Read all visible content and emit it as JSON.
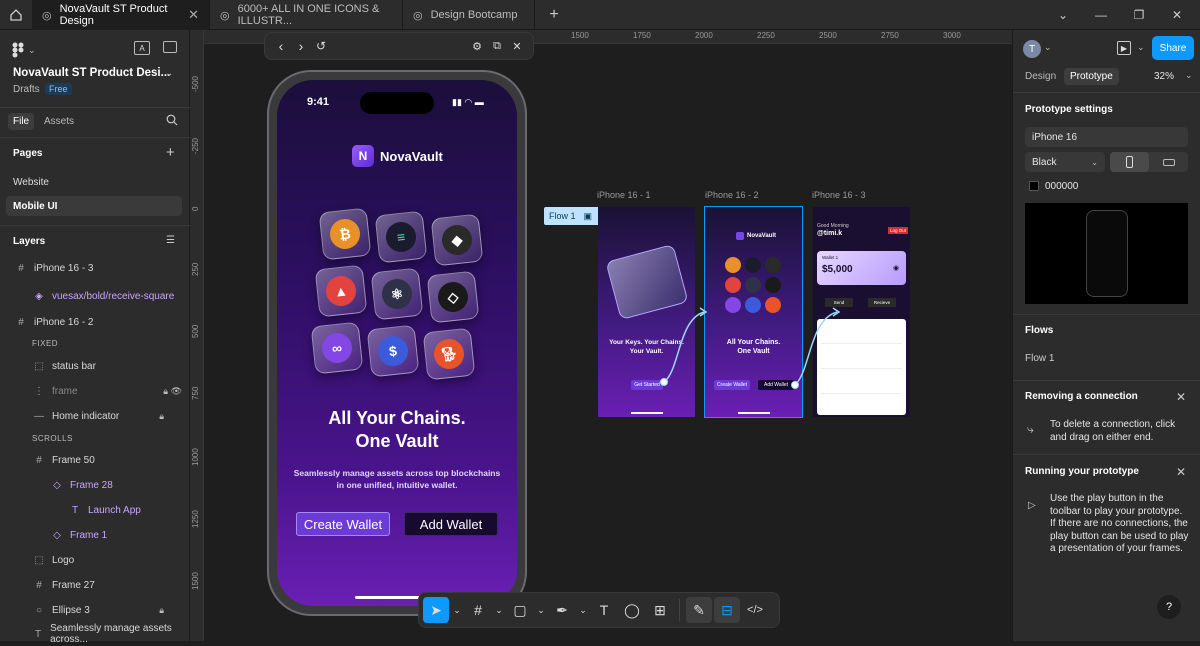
{
  "tabs": [
    {
      "label": "NovaVault ST Product Design",
      "active": true
    },
    {
      "label": "6000+ ALL IN ONE ICONS & ILLUSTR...",
      "active": false
    },
    {
      "label": "Design Bootcamp",
      "active": false
    }
  ],
  "left": {
    "file_title": "NovaVault ST Product Desi...",
    "drafts": "Drafts",
    "plan": "Free",
    "tab_file": "File",
    "tab_assets": "Assets",
    "pages_title": "Pages",
    "pages": [
      "Website",
      "Mobile UI"
    ],
    "layers_title": "Layers",
    "layers": [
      {
        "label": "iPhone 16 - 3",
        "icon": "#"
      },
      {
        "label": "vuesax/bold/receive-square",
        "icon": "◈"
      },
      {
        "label": "iPhone 16 - 2",
        "icon": "#"
      },
      {
        "label": "FIXED",
        "icon": ""
      },
      {
        "label": "status bar",
        "icon": "⬚"
      },
      {
        "label": "frame",
        "icon": "⋮"
      },
      {
        "label": "Home indicator",
        "icon": "—"
      },
      {
        "label": "SCROLLS",
        "icon": ""
      },
      {
        "label": "Frame 50",
        "icon": "#"
      },
      {
        "label": "Frame 28",
        "icon": "◇"
      },
      {
        "label": "Launch App",
        "icon": "T"
      },
      {
        "label": "Frame 1",
        "icon": "◇"
      },
      {
        "label": "Logo",
        "icon": "⬚"
      },
      {
        "label": "Frame 27",
        "icon": "#"
      },
      {
        "label": "Ellipse 3",
        "icon": "○"
      },
      {
        "label": "Seamlessly manage assets across...",
        "icon": "T"
      }
    ]
  },
  "ruler_top": [
    "1500",
    "1750",
    "2000",
    "2250",
    "2500",
    "2750",
    "3000"
  ],
  "ruler_left": [
    "-500",
    "-250",
    "0",
    "250",
    "500",
    "750",
    "1000",
    "1250",
    "1500"
  ],
  "phone": {
    "time": "9:41",
    "brand": "NovaVault",
    "headline1": "All Your Chains.",
    "headline2": "One Vault",
    "sub1": "Seamlessly manage assets across top blockchains",
    "sub2": "in one unified, intuitive wallet.",
    "btn_create": "Create Wallet",
    "btn_add": "Add Wallet"
  },
  "frames": {
    "f1": "iPhone 16 - 1",
    "f2": "iPhone 16 - 2",
    "f3": "iPhone 16 - 3",
    "flow_tag": "Flow 1",
    "f1_line1": "Your Keys. Your Chains.",
    "f1_line2": "Your Vault.",
    "f1_btn": "Get Started",
    "f2_brand": "NovaVault",
    "f2_line1": "All Your Chains.",
    "f2_line2": "One Vault",
    "f2_btn1": "Create Wallet",
    "f2_btn2": "Add Wallet",
    "f3_greeting": "Good Morning",
    "f3_user": "@timi.k",
    "f3_logout": "Log Out",
    "f3_wallet": "Wallet 1",
    "f3_balance": "$5,000",
    "f3_send": "Send",
    "f3_receive": "Recieve"
  },
  "right": {
    "avatar": "T",
    "share": "Share",
    "tab_design": "Design",
    "tab_prototype": "Prototype",
    "zoom": "32%",
    "settings_title": "Prototype settings",
    "device": "iPhone 16",
    "color_mode": "Black",
    "bg_hex": "000000",
    "flows_title": "Flows",
    "flow_item": "Flow 1",
    "removing_title": "Removing a connection",
    "removing_body": "To delete a connection, click and drag on either end.",
    "running_title": "Running your prototype",
    "running_body": "Use the play button in the toolbar to play your prototype. If there are no connections, the play button can be used to play a presentation of your frames.",
    "help": "?"
  },
  "colors": {
    "accent": "#0d99ff",
    "purple": "#6a1fb4",
    "tag": "#bde3ff"
  }
}
